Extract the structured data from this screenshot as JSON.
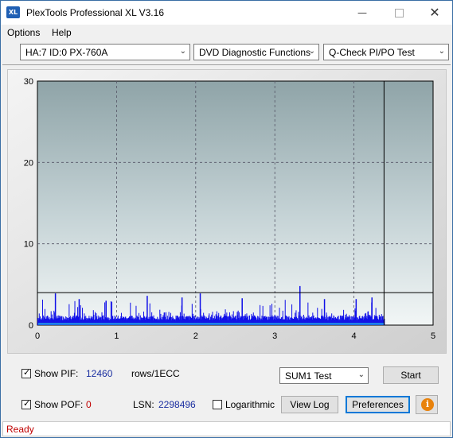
{
  "window": {
    "title": "PlexTools Professional XL V3.16",
    "app_icon_text": "XL"
  },
  "menu": [
    "Options",
    "Help"
  ],
  "toolbar": {
    "drive": "HA:7 ID:0  PX-760A",
    "function": "DVD Diagnostic Functions",
    "test": "Q-Check PI/PO Test"
  },
  "chart_data": {
    "type": "bar",
    "xlim": [
      0,
      5
    ],
    "ylim": [
      0,
      30
    ],
    "x_ticks": [
      "0",
      "1",
      "2",
      "3",
      "4",
      "5"
    ],
    "y_ticks": [
      "0",
      "10",
      "20",
      "30"
    ],
    "grid": true,
    "end_marker_x": 4.38,
    "threshold_y": 4,
    "pif_baseline": 0.6,
    "po_baseline": 0.15,
    "notes_visible_spikes": [
      {
        "x": 0.22,
        "y": 3.9
      },
      {
        "x": 0.52,
        "y": 3.2
      },
      {
        "x": 0.86,
        "y": 3.0
      },
      {
        "x": 1.38,
        "y": 3.6
      },
      {
        "x": 1.82,
        "y": 3.4
      },
      {
        "x": 2.05,
        "y": 3.9
      },
      {
        "x": 2.58,
        "y": 3.3
      },
      {
        "x": 3.31,
        "y": 4.8
      },
      {
        "x": 3.62,
        "y": 3.2
      },
      {
        "x": 4.02,
        "y": 3.2
      },
      {
        "x": 4.22,
        "y": 3.4
      }
    ]
  },
  "controls": {
    "show_pif_label": "Show PIF:",
    "pif_value": "12460",
    "pif_unit": "rows/1ECC",
    "show_pof_label": "Show POF:",
    "pof_value": "0",
    "lsn_label": "LSN:",
    "lsn_value": "2298496",
    "logarithmic_label": "Logarithmic",
    "sum_select": "SUM1 Test",
    "start_label": "Start",
    "viewlog_label": "View Log",
    "preferences_label": "Preferences"
  },
  "status": "Ready"
}
